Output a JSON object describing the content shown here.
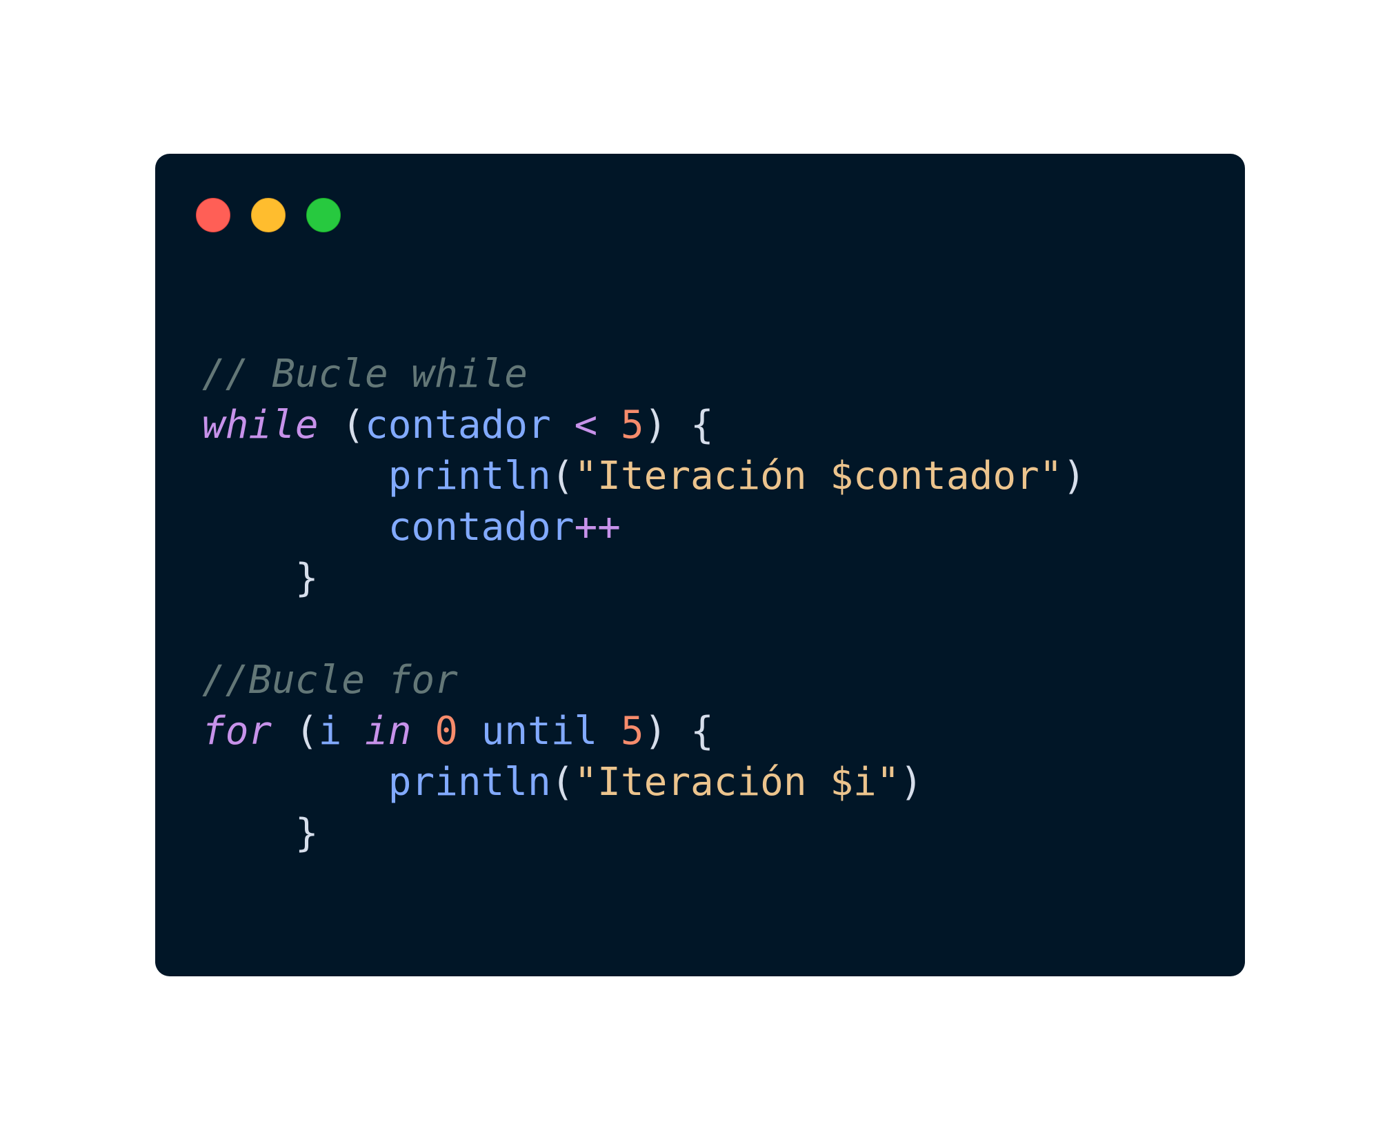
{
  "window": {
    "background": "#011627",
    "controls": [
      {
        "name": "close-button",
        "color": "#ff5f56",
        "border": "#e0443e"
      },
      {
        "name": "minimize-button",
        "color": "#ffbd2e",
        "border": "#dea123"
      },
      {
        "name": "maximize-button",
        "color": "#27c93f",
        "border": "#1aab29"
      }
    ]
  },
  "colors": {
    "comment": "#637777",
    "keyword": "#c792ea",
    "identifier": "#82aaff",
    "number": "#f78c6c",
    "string": "#ecc48d",
    "punctuation": "#d6deeb"
  },
  "code": {
    "lines": [
      [
        {
          "t": "comment",
          "v": "// Bucle while"
        }
      ],
      [
        {
          "t": "keyword",
          "v": "while"
        },
        {
          "t": "space",
          "v": " "
        },
        {
          "t": "punct",
          "v": "("
        },
        {
          "t": "ident",
          "v": "contador"
        },
        {
          "t": "space",
          "v": " "
        },
        {
          "t": "operator",
          "v": "<"
        },
        {
          "t": "space",
          "v": " "
        },
        {
          "t": "number",
          "v": "5"
        },
        {
          "t": "punct",
          "v": ") {"
        }
      ],
      [
        {
          "t": "space",
          "v": "        "
        },
        {
          "t": "func",
          "v": "println"
        },
        {
          "t": "punct",
          "v": "("
        },
        {
          "t": "string",
          "v": "\"Iteración $contador\""
        },
        {
          "t": "punct",
          "v": ")"
        }
      ],
      [
        {
          "t": "space",
          "v": "        "
        },
        {
          "t": "ident",
          "v": "contador"
        },
        {
          "t": "operator",
          "v": "++"
        }
      ],
      [
        {
          "t": "space",
          "v": "    "
        },
        {
          "t": "punct",
          "v": "}"
        }
      ],
      [],
      [
        {
          "t": "comment",
          "v": "//Bucle for"
        }
      ],
      [
        {
          "t": "keyword",
          "v": "for"
        },
        {
          "t": "space",
          "v": " "
        },
        {
          "t": "punct",
          "v": "("
        },
        {
          "t": "ident",
          "v": "i"
        },
        {
          "t": "space",
          "v": " "
        },
        {
          "t": "keyword",
          "v": "in"
        },
        {
          "t": "space",
          "v": " "
        },
        {
          "t": "number",
          "v": "0"
        },
        {
          "t": "space",
          "v": " "
        },
        {
          "t": "ident",
          "v": "until"
        },
        {
          "t": "space",
          "v": " "
        },
        {
          "t": "number",
          "v": "5"
        },
        {
          "t": "punct",
          "v": ") {"
        }
      ],
      [
        {
          "t": "space",
          "v": "        "
        },
        {
          "t": "func",
          "v": "println"
        },
        {
          "t": "punct",
          "v": "("
        },
        {
          "t": "string",
          "v": "\"Iteración $i\""
        },
        {
          "t": "punct",
          "v": ")"
        }
      ],
      [
        {
          "t": "space",
          "v": "    "
        },
        {
          "t": "punct",
          "v": "}"
        }
      ]
    ]
  }
}
